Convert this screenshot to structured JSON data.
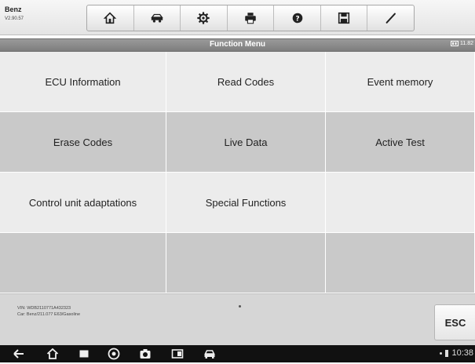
{
  "app": {
    "brand": "Benz",
    "version": "V2.90.57"
  },
  "toolbar": {
    "tools": [
      {
        "name": "home-button",
        "icon": "home-icon"
      },
      {
        "name": "vehicle-swap-button",
        "icon": "vehicle-swap-icon"
      },
      {
        "name": "settings-button",
        "icon": "gear-icon"
      },
      {
        "name": "print-button",
        "icon": "printer-icon"
      },
      {
        "name": "help-button",
        "icon": "help-icon"
      },
      {
        "name": "save-button",
        "icon": "floppy-disk-icon"
      },
      {
        "name": "edit-button",
        "icon": "pen-icon"
      }
    ]
  },
  "titlebar": {
    "title": "Function Menu",
    "battery": "11.82"
  },
  "menu": {
    "items": [
      "ECU Information",
      "Read Codes",
      "Event memory",
      "Erase Codes",
      "Live Data",
      "Active Test",
      "Control unit adaptations",
      "Special Functions",
      "",
      "",
      "",
      ""
    ]
  },
  "footer": {
    "vin": "VIN: WDB2110771A432323",
    "car": "Car: Benz/211.077 E63/Gasoline",
    "esc_label": "ESC"
  },
  "status": {
    "time": "10:38"
  },
  "colors": {
    "navbar": "#111111",
    "titlebar": "#8a8a8a",
    "cell_light": "#ececec",
    "cell_dark": "#c9c9c9"
  }
}
